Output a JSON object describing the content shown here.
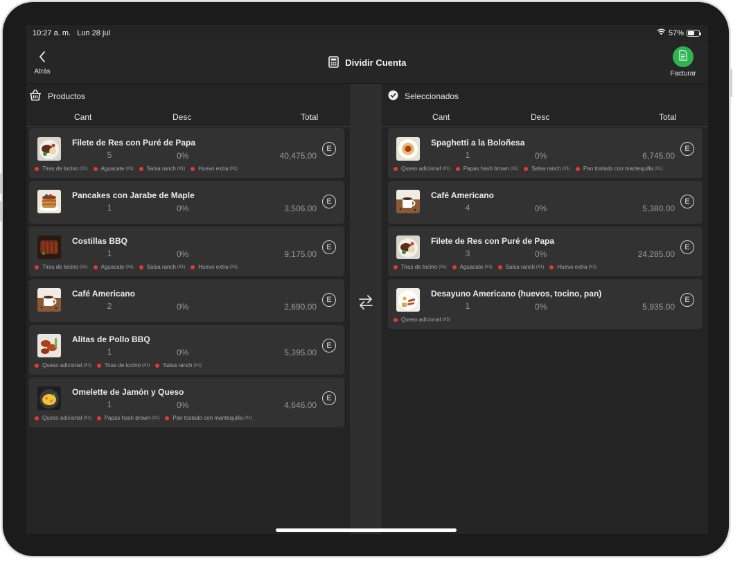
{
  "status": {
    "time": "10:27 a. m.",
    "date": "Lun 28 jul",
    "battery": "57%",
    "battery_level": 0.57
  },
  "nav": {
    "back_label": "Atrás",
    "title": "Dividir Cuenta",
    "facturar_label": "Facturar"
  },
  "left": {
    "section": "Productos",
    "columns": {
      "cant": "Cant",
      "desc": "Desc",
      "total": "Total"
    },
    "items": [
      {
        "name": "Filete de Res con Puré de Papa",
        "qty": "5",
        "desc": "0%",
        "total": "40,475.00",
        "edit": "E",
        "thumb": "steak",
        "mods": [
          {
            "t": "Tiras de tocino",
            "m": "(X1)"
          },
          {
            "t": "Aguacate",
            "m": "(X1)"
          },
          {
            "t": "Salsa ranch",
            "m": "(X1)"
          },
          {
            "t": "Huevo extra",
            "m": "(X1)"
          }
        ]
      },
      {
        "name": "Pancakes con Jarabe de Maple",
        "qty": "1",
        "desc": "0%",
        "total": "3,506.00",
        "edit": "E",
        "thumb": "pancakes",
        "mods": []
      },
      {
        "name": "Costillas BBQ",
        "qty": "1",
        "desc": "0%",
        "total": "9,175.00",
        "edit": "E",
        "thumb": "ribs",
        "mods": [
          {
            "t": "Tiras de tocino",
            "m": "(X1)"
          },
          {
            "t": "Aguacate",
            "m": "(X1)"
          },
          {
            "t": "Salsa ranch",
            "m": "(X1)"
          },
          {
            "t": "Huevo extra",
            "m": "(X1)"
          }
        ]
      },
      {
        "name": "Café Americano",
        "qty": "2",
        "desc": "0%",
        "total": "2,690.00",
        "edit": "E",
        "thumb": "coffee",
        "mods": []
      },
      {
        "name": "Alitas de Pollo BBQ",
        "qty": "1",
        "desc": "0%",
        "total": "5,395.00",
        "edit": "E",
        "thumb": "wings",
        "mods": [
          {
            "t": "Queso adicional",
            "m": "(X1)"
          },
          {
            "t": "Tiras de tocino",
            "m": "(X1)"
          },
          {
            "t": "Salsa ranch",
            "m": "(X1)"
          }
        ]
      },
      {
        "name": "Omelette de Jamón y Queso",
        "qty": "1",
        "desc": "0%",
        "total": "4,646.00",
        "edit": "E",
        "thumb": "omelette",
        "mods": [
          {
            "t": "Queso adicional",
            "m": "(X1)"
          },
          {
            "t": "Papas hash brown",
            "m": "(X1)"
          },
          {
            "t": "Pan tostado con mantequilla",
            "m": "(X1)"
          }
        ]
      }
    ]
  },
  "right": {
    "section": "Seleccionados",
    "columns": {
      "cant": "Cant",
      "desc": "Desc",
      "total": "Total"
    },
    "items": [
      {
        "name": "Spaghetti a la Boloñesa",
        "qty": "1",
        "desc": "0%",
        "total": "6,745.00",
        "edit": "E",
        "thumb": "spaghetti",
        "mods": [
          {
            "t": "Queso adicional",
            "m": "(X1)"
          },
          {
            "t": "Papas hash brown",
            "m": "(X1)"
          },
          {
            "t": "Salsa ranch",
            "m": "(X1)"
          },
          {
            "t": "Pan tostado con mantequilla",
            "m": "(X1)"
          }
        ]
      },
      {
        "name": "Café Americano",
        "qty": "4",
        "desc": "0%",
        "total": "5,380.00",
        "edit": "E",
        "thumb": "coffee",
        "mods": []
      },
      {
        "name": "Filete de Res con Puré de Papa",
        "qty": "3",
        "desc": "0%",
        "total": "24,285.00",
        "edit": "E",
        "thumb": "steak",
        "mods": [
          {
            "t": "Tiras de tocino",
            "m": "(X1)"
          },
          {
            "t": "Aguacate",
            "m": "(X1)"
          },
          {
            "t": "Salsa ranch",
            "m": "(X1)"
          },
          {
            "t": "Huevo extra",
            "m": "(X1)"
          }
        ]
      },
      {
        "name": "Desayuno Americano (huevos, tocino, pan)",
        "qty": "1",
        "desc": "0%",
        "total": "5,935.00",
        "edit": "E",
        "thumb": "breakfast",
        "mods": [
          {
            "t": "Queso adicional",
            "m": "(X5)"
          }
        ]
      }
    ]
  },
  "colors": {
    "accent_green": "#2fb350",
    "modifier_dot": "#e53935"
  }
}
